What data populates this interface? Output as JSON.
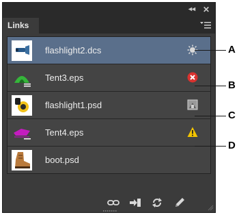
{
  "panel": {
    "tab_label": "Links",
    "controls": {
      "collapse_glyph": "◂◂",
      "close_glyph": "✕"
    }
  },
  "links": [
    {
      "filename": "flashlight2.dcs",
      "status_icon": "modified-link-icon",
      "selected": true
    },
    {
      "filename": "Tent3.eps",
      "status_icon": "missing-link-icon",
      "selected": false
    },
    {
      "filename": "flashlight1.psd",
      "status_icon": "embedded-link-icon",
      "selected": false
    },
    {
      "filename": "Tent4.eps",
      "status_icon": "warning-icon",
      "selected": false
    },
    {
      "filename": "boot.psd",
      "status_icon": "",
      "selected": false
    }
  ],
  "footer_icons": [
    "relink-icon",
    "go-to-link-icon",
    "update-link-icon",
    "edit-original-icon"
  ],
  "callouts": [
    "A",
    "B",
    "C",
    "D"
  ],
  "colors": {
    "panel_bg": "#3b3b3b",
    "selected_row": "#5a6f8b",
    "missing": "#d9322f",
    "warning": "#f3c400"
  }
}
